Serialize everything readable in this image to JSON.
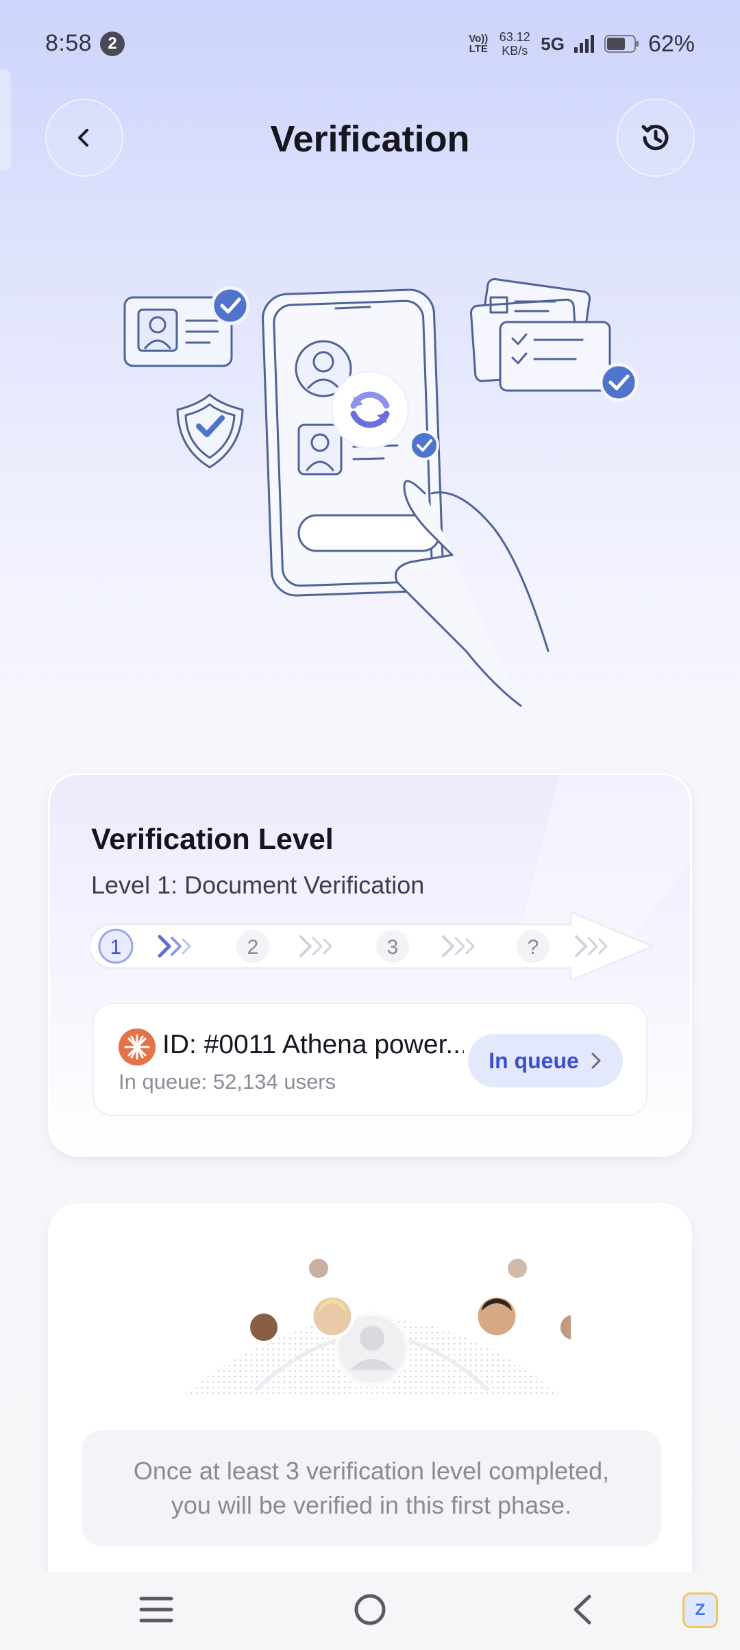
{
  "status_bar": {
    "time": "8:58",
    "notification_count": "2",
    "volte": "Vo)) LTE",
    "net_speed_value": "63.12",
    "net_speed_unit": "KB/s",
    "network": "5G",
    "battery": "62%"
  },
  "header": {
    "title": "Verification",
    "back_icon": "chevron-left-icon",
    "history_icon": "history-icon"
  },
  "hero": {
    "illustration": "phone-verification-illustration"
  },
  "level_card": {
    "title": "Verification Level",
    "subtitle": "Level 1: Document Verification",
    "steps": [
      "1",
      "2",
      "3",
      "?"
    ],
    "current_step": 1,
    "queue": {
      "name": "ID: #0011 Athena power...",
      "count_text": "In queue: 52,134 users",
      "button_label": "In queue"
    }
  },
  "info_card": {
    "line1": "Once at least 3 verification level completed,",
    "line2": "you will be verified in this first phase."
  },
  "bottom_nav": {
    "menu": "menu-icon",
    "home": "home-circle-icon",
    "back": "back-icon",
    "app_badge": "Z"
  },
  "colors": {
    "accent": "#3a4fc8",
    "step_active": "#5a6fd8",
    "step_inactive": "#c8cbd8",
    "illustration_stroke": "#4f6396",
    "check_blue": "#4e74cc"
  }
}
